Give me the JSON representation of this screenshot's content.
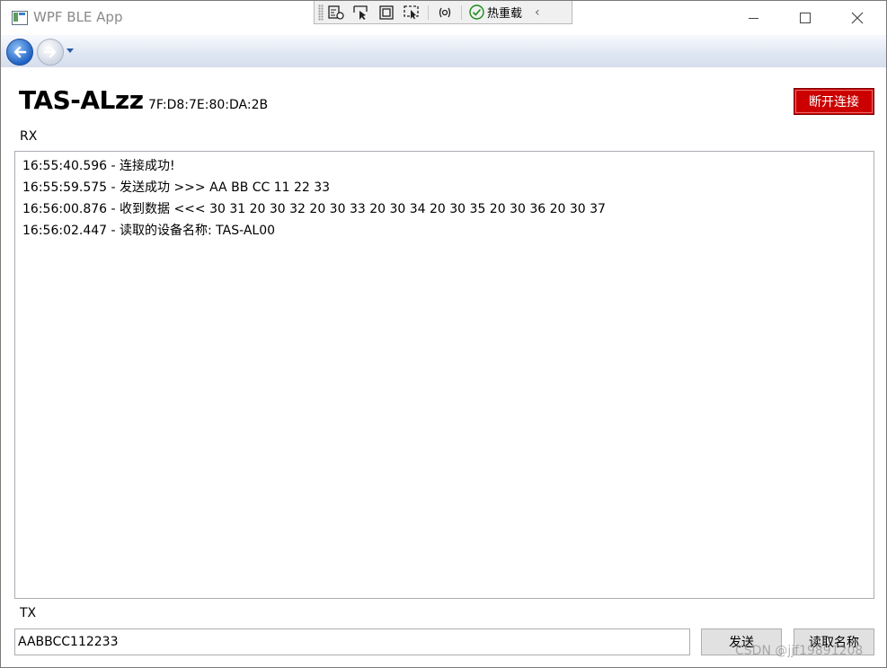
{
  "window": {
    "title": "WPF BLE App"
  },
  "devtools": {
    "hot_reload_label": "热重载"
  },
  "device": {
    "name": "TAS-ALzz",
    "address": "7F:D8:7E:80:DA:2B",
    "disconnect_label": "断开连接"
  },
  "rx": {
    "label": "RX",
    "lines": [
      "16:55:40.596 - 连接成功!",
      "16:55:59.575 - 发送成功 >>> AA BB CC 11 22 33",
      "16:56:00.876 - 收到数据 <<< 30 31 20 30 32 20 30 33 20 30 34 20 30 35 20 30 36 20 30 37",
      "16:56:02.447 - 读取的设备名称: TAS-AL00"
    ]
  },
  "tx": {
    "label": "TX",
    "value": "AABBCC112233",
    "send_label": "发送",
    "read_name_label": "读取名称"
  },
  "watermark": "CSDN @jjf19891208",
  "colors": {
    "disconnect_bg": "#cc0000",
    "nav_back": "#1f62c4"
  }
}
